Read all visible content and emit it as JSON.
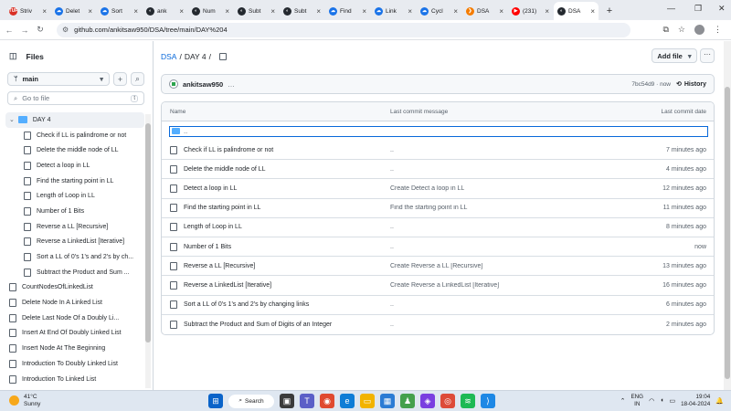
{
  "browser": {
    "tabs": [
      {
        "title": "Striv",
        "color": "#d93025",
        "glyph": "TUF",
        "active": false
      },
      {
        "title": "Delet",
        "color": "#1a73e8",
        "glyph": "☁",
        "active": false
      },
      {
        "title": "Sort",
        "color": "#1a73e8",
        "glyph": "☁",
        "active": false
      },
      {
        "title": "ank",
        "color": "#24292f",
        "glyph": "◐",
        "active": false
      },
      {
        "title": "Num",
        "color": "#24292f",
        "glyph": "◐",
        "active": false
      },
      {
        "title": "Subt",
        "color": "#24292f",
        "glyph": "◐",
        "active": false
      },
      {
        "title": "Subt",
        "color": "#24292f",
        "glyph": "◐",
        "active": false
      },
      {
        "title": "Find",
        "color": "#1a73e8",
        "glyph": "☁",
        "active": false
      },
      {
        "title": "Link",
        "color": "#1a73e8",
        "glyph": "☁",
        "active": false
      },
      {
        "title": "Cycl",
        "color": "#1a73e8",
        "glyph": "☁",
        "active": false
      },
      {
        "title": "DSA",
        "color": "#f57c00",
        "glyph": "❯",
        "active": false
      },
      {
        "title": "(231)",
        "color": "#ff0000",
        "glyph": "▶",
        "active": false
      },
      {
        "title": "DSA",
        "color": "#24292f",
        "glyph": "◐",
        "active": true
      }
    ],
    "url": "github.com/ankitsaw950/DSA/tree/main/DAY%204",
    "new_tab": "+",
    "min": "—",
    "max": "❐",
    "close": "✕"
  },
  "sidebar": {
    "title": "Files",
    "branch": "main",
    "go_to_file": "Go to file",
    "shortcut": "t",
    "folder": "DAY 4",
    "folder_items": [
      "Check if LL is palindrome or not",
      "Delete the middle node of LL",
      "Detect a loop in LL",
      "Find the starting point in LL",
      "Length of Loop in LL",
      "Number of 1 Bits",
      "Reverse a LL [Recursive]",
      "Reverse a LinkedList [Iterative]",
      "Sort a LL of 0's 1's and 2's by ch...",
      "Subtract the Product and Sum ..."
    ],
    "root_items": [
      "CountNodesOfLinkedList",
      "Delete Node In A Linked List",
      "Delete Last Node Of a Doubly Li...",
      "Insert At End Of Doubly Linked List",
      "Insert Node At The Beginning",
      "Introduction To Doubly Linked List",
      "Introduction To Linked List"
    ]
  },
  "main": {
    "breadcrumb_repo": "DSA",
    "breadcrumb_sep": "/",
    "breadcrumb_dir": "DAY 4",
    "breadcrumb_trail": "/",
    "add_file": "Add file",
    "more": "···",
    "commit": {
      "author": "ankitsaw950",
      "message": "…",
      "hash": "7bc54d9 · now",
      "history": "History"
    },
    "table": {
      "headers": {
        "name": "Name",
        "message": "Last commit message",
        "date": "Last commit date"
      },
      "parent": "..",
      "rows": [
        {
          "name": "Check if LL is palindrome or not",
          "message": "..",
          "date": "7 minutes ago"
        },
        {
          "name": "Delete the middle node of LL",
          "message": "..",
          "date": "4 minutes ago"
        },
        {
          "name": "Detect a loop in LL",
          "message": "Create Detect a loop in LL",
          "date": "12 minutes ago"
        },
        {
          "name": "Find the starting point in LL",
          "message": "Find the starting point in LL",
          "date": "11 minutes ago"
        },
        {
          "name": "Length of Loop in LL",
          "message": "..",
          "date": "8 minutes ago"
        },
        {
          "name": "Number of 1 Bits",
          "message": "..",
          "date": "now"
        },
        {
          "name": "Reverse a LL [Recursive]",
          "message": "Create Reverse a LL [Recursive]",
          "date": "13 minutes ago"
        },
        {
          "name": "Reverse a LinkedList [Iterative]",
          "message": "Create Reverse a LinkedList [Iterative]",
          "date": "16 minutes ago"
        },
        {
          "name": "Sort a LL of 0's 1's and 2's by changing links",
          "message": "..",
          "date": "6 minutes ago"
        },
        {
          "name": "Subtract the Product and Sum of Digits of an Integer",
          "message": "..",
          "date": "2 minutes ago"
        }
      ]
    }
  },
  "taskbar": {
    "temp": "41°C",
    "condition": "Sunny",
    "search": "Search",
    "lang1": "ENG",
    "lang2": "IN",
    "time": "19:04",
    "date": "18-04-2024"
  },
  "colors": {
    "accent": "#0969da",
    "folder": "#54aeff",
    "border": "#d0d7de"
  }
}
